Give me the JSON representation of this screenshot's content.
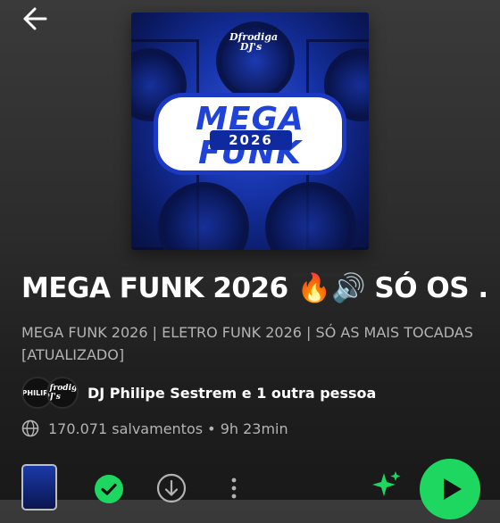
{
  "header": {
    "back_icon": "arrow-left-icon"
  },
  "cover": {
    "logo_text": "Dfrodiga DJ's",
    "badge_line1": "MEGA",
    "badge_year": "2026",
    "badge_line2": "FUNK"
  },
  "playlist": {
    "title": "MEGA FUNK 2026 🔥🔊 SÓ OS ...",
    "description": "MEGA FUNK 2026 | ELETRO FUNK 2026 | SÓ AS MAIS TOCADAS [ATUALIZADO]",
    "owners": "DJ Philipe Sestrem e 1 outra pessoa",
    "avatar1_text": "PHILIPE",
    "avatar2_text": "Dfrodiga DJ's",
    "meta": "170.071 salvamentos • 9h 23min"
  },
  "controls": {
    "saved_icon": "check-circle-icon",
    "download_icon": "download-icon",
    "more_icon": "more-vertical-icon",
    "sparkle_icon": "sparkle-icon",
    "play_icon": "play-icon"
  },
  "colors": {
    "accent": "#1ed760",
    "badge_blue": "#1f43d8"
  }
}
